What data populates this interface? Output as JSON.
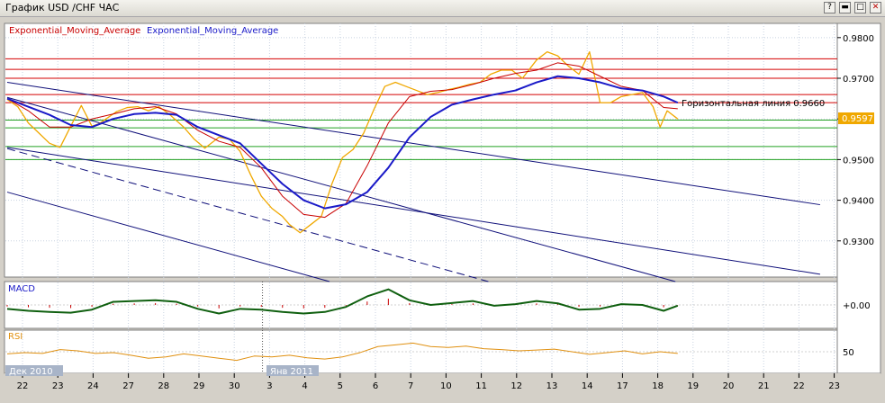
{
  "window": {
    "title": "График USD /CHF  ЧАС",
    "buttons": [
      {
        "name": "help",
        "glyph": "?"
      },
      {
        "name": "minimize",
        "glyph": "▬"
      },
      {
        "name": "maximize",
        "glyph": "□"
      },
      {
        "name": "close",
        "glyph": "✕"
      }
    ]
  },
  "colors": {
    "price": "#f0a800",
    "ema_slow": "#1a1ac8",
    "ema_fast": "#c80000",
    "resistance": "#d40000",
    "support": "#20a020",
    "trend": "#10107a",
    "macd": "#106010",
    "rsi": "#e09010",
    "grid": "#c8d2e0"
  },
  "chart_data": [
    {
      "type": "line",
      "title": "",
      "legend": [
        "Exponential_Moving_Average",
        "Exponential_Moving_Average"
      ],
      "y_ticks": [
        "0.9300",
        "0.9400",
        "0.9500",
        "0.9600",
        "0.9700",
        "0.9800"
      ],
      "ylim": [
        0.9211,
        0.9835
      ],
      "last_price": "0.9597",
      "annotation": "Горизонтальная линия 0.9660",
      "horizontal_lines": [
        {
          "value": 0.9748,
          "color": "resistance"
        },
        {
          "value": 0.9722,
          "color": "resistance"
        },
        {
          "value": 0.97,
          "color": "resistance"
        },
        {
          "value": 0.966,
          "color": "resistance"
        },
        {
          "value": 0.964,
          "color": "resistance"
        },
        {
          "value": 0.9597,
          "color": "support"
        },
        {
          "value": 0.9578,
          "color": "support"
        },
        {
          "value": 0.9532,
          "color": "support"
        },
        {
          "value": 0.95,
          "color": "support"
        }
      ],
      "trend_lines": [
        {
          "start": [
            0,
            0.969
          ],
          "end": [
            22.6,
            0.9389
          ],
          "dashed": false
        },
        {
          "start": [
            0,
            0.9653
          ],
          "end": [
            18.5,
            0.92
          ],
          "dashed": false
        },
        {
          "start": [
            0,
            0.953
          ],
          "end": [
            22.6,
            0.9218
          ],
          "dashed": false
        },
        {
          "start": [
            0,
            0.9527
          ],
          "end": [
            13.2,
            0.92
          ],
          "dashed": true
        },
        {
          "start": [
            0,
            0.942
          ],
          "end": [
            8.7,
            0.92
          ],
          "dashed": false
        }
      ],
      "series": [
        {
          "role": "price",
          "x": [
            0,
            0.3,
            0.6,
            0.9,
            1.2,
            1.5,
            1.8,
            2.1,
            2.4,
            2.6,
            2.8,
            3.1,
            3.4,
            3.7,
            4.0,
            4.3,
            4.6,
            5.0,
            5.3,
            5.6,
            6.0,
            6.3,
            6.6,
            6.9,
            7.2,
            7.5,
            7.8,
            8.0,
            8.3,
            8.6,
            8.9,
            9.2,
            9.5,
            9.8,
            10.1,
            10.4,
            10.7,
            11.0,
            11.3,
            11.6,
            11.9,
            12.2,
            12.5,
            12.8,
            13.1,
            13.4,
            13.7,
            14.0,
            14.3,
            14.6,
            15.0,
            15.3,
            15.6,
            15.9,
            16.2,
            16.5,
            16.8,
            17.1,
            17.4,
            17.7,
            18.0,
            18.3,
            18.5,
            18.7,
            19.0
          ],
          "values": [
            0.9648,
            0.963,
            0.959,
            0.9565,
            0.954,
            0.953,
            0.9582,
            0.9633,
            0.9582,
            0.9588,
            0.96,
            0.9618,
            0.9628,
            0.963,
            0.962,
            0.963,
            0.9611,
            0.958,
            0.955,
            0.9528,
            0.9555,
            0.955,
            0.952,
            0.9462,
            0.941,
            0.938,
            0.936,
            0.934,
            0.932,
            0.934,
            0.936,
            0.944,
            0.9505,
            0.9525,
            0.9565,
            0.9625,
            0.968,
            0.969,
            0.968,
            0.967,
            0.966,
            0.9665,
            0.9672,
            0.9678,
            0.9685,
            0.969,
            0.971,
            0.972,
            0.972,
            0.97,
            0.9745,
            0.9765,
            0.9755,
            0.973,
            0.971,
            0.9765,
            0.964,
            0.964,
            0.9655,
            0.966,
            0.9665,
            0.963,
            0.958,
            0.962,
            0.96
          ]
        },
        {
          "role": "ema_fast",
          "x": [
            0,
            0.6,
            1.2,
            1.8,
            2.4,
            3.0,
            3.6,
            4.2,
            4.8,
            5.4,
            6.0,
            6.6,
            7.2,
            7.8,
            8.4,
            9.0,
            9.6,
            10.2,
            10.8,
            11.4,
            12.0,
            12.6,
            13.2,
            13.8,
            14.4,
            15.0,
            15.6,
            16.2,
            16.8,
            17.4,
            18.0,
            18.6,
            19.0
          ],
          "values": [
            0.965,
            0.962,
            0.958,
            0.958,
            0.96,
            0.9612,
            0.9625,
            0.963,
            0.9612,
            0.9572,
            0.9545,
            0.953,
            0.948,
            0.941,
            0.9365,
            0.9358,
            0.9392,
            0.9485,
            0.959,
            0.9655,
            0.9668,
            0.9672,
            0.9685,
            0.97,
            0.9712,
            0.972,
            0.9738,
            0.973,
            0.9705,
            0.968,
            0.967,
            0.9628,
            0.9625
          ]
        },
        {
          "role": "ema_slow",
          "x": [
            0,
            0.6,
            1.2,
            1.8,
            2.4,
            3.0,
            3.6,
            4.2,
            4.8,
            5.4,
            6.0,
            6.6,
            7.2,
            7.8,
            8.4,
            9.0,
            9.6,
            10.2,
            10.8,
            11.4,
            12.0,
            12.6,
            13.2,
            13.8,
            14.4,
            15.0,
            15.6,
            16.2,
            16.8,
            17.4,
            18.0,
            18.6,
            19.0
          ],
          "values": [
            0.965,
            0.963,
            0.961,
            0.9585,
            0.958,
            0.96,
            0.9612,
            0.9615,
            0.961,
            0.958,
            0.956,
            0.954,
            0.949,
            0.944,
            0.94,
            0.938,
            0.939,
            0.942,
            0.948,
            0.9555,
            0.9605,
            0.9635,
            0.9648,
            0.966,
            0.967,
            0.969,
            0.9705,
            0.97,
            0.969,
            0.9675,
            0.967,
            0.9655,
            0.964
          ]
        }
      ]
    },
    {
      "type": "line",
      "label": "MACD",
      "y_ticks": [
        "+0.00"
      ],
      "ylim": [
        -0.006,
        0.006
      ],
      "series": [
        {
          "role": "macd",
          "x": [
            0,
            0.6,
            1.2,
            1.8,
            2.4,
            3.0,
            3.6,
            4.2,
            4.8,
            5.4,
            6.0,
            6.6,
            7.2,
            7.8,
            8.4,
            9.0,
            9.6,
            10.2,
            10.8,
            11.4,
            12.0,
            12.6,
            13.2,
            13.8,
            14.4,
            15.0,
            15.6,
            16.2,
            16.8,
            17.4,
            18.0,
            18.6,
            19.0
          ],
          "values": [
            -0.001,
            -0.0015,
            -0.0018,
            -0.002,
            -0.0012,
            0.0008,
            0.001,
            0.0012,
            0.0008,
            -0.001,
            -0.0022,
            -0.001,
            -0.0012,
            -0.0018,
            -0.0022,
            -0.0018,
            -0.0005,
            0.0022,
            0.004,
            0.0012,
            0.0,
            0.0005,
            0.001,
            -0.0002,
            0.0002,
            0.001,
            0.0004,
            -0.0012,
            -0.001,
            0.0002,
            0.0,
            -0.0015,
            -0.0002
          ]
        }
      ]
    },
    {
      "type": "line",
      "label": "RSI",
      "y_ticks": [
        "50"
      ],
      "ylim": [
        0,
        100
      ],
      "series": [
        {
          "role": "rsi",
          "x": [
            0,
            0.5,
            1.0,
            1.5,
            2.0,
            2.5,
            3.0,
            3.5,
            4.0,
            4.5,
            5.0,
            5.5,
            6.0,
            6.5,
            7.0,
            7.5,
            8.0,
            8.5,
            9.0,
            9.5,
            10.0,
            10.5,
            11.0,
            11.5,
            12.0,
            12.5,
            13.0,
            13.5,
            14.0,
            14.5,
            15.0,
            15.5,
            16.0,
            16.5,
            17.0,
            17.5,
            18.0,
            18.5,
            19.0
          ],
          "values": [
            45,
            48,
            46,
            55,
            52,
            46,
            48,
            42,
            35,
            38,
            45,
            40,
            35,
            30,
            40,
            38,
            42,
            36,
            33,
            38,
            48,
            62,
            66,
            70,
            62,
            60,
            63,
            57,
            55,
            52,
            54,
            56,
            50,
            44,
            48,
            52,
            45,
            50,
            46
          ]
        }
      ]
    }
  ],
  "x_axis": {
    "labels": [
      "22",
      "23",
      "24",
      "27",
      "28",
      "29",
      "30",
      "3",
      "4",
      "5",
      "6",
      "7",
      "10",
      "11",
      "12",
      "13",
      "14",
      "17",
      "18",
      "19",
      "20",
      "21",
      "22",
      "23"
    ],
    "period_labels": [
      {
        "text": "Дек 2010"
      },
      {
        "text": "Янв 2011"
      }
    ]
  }
}
